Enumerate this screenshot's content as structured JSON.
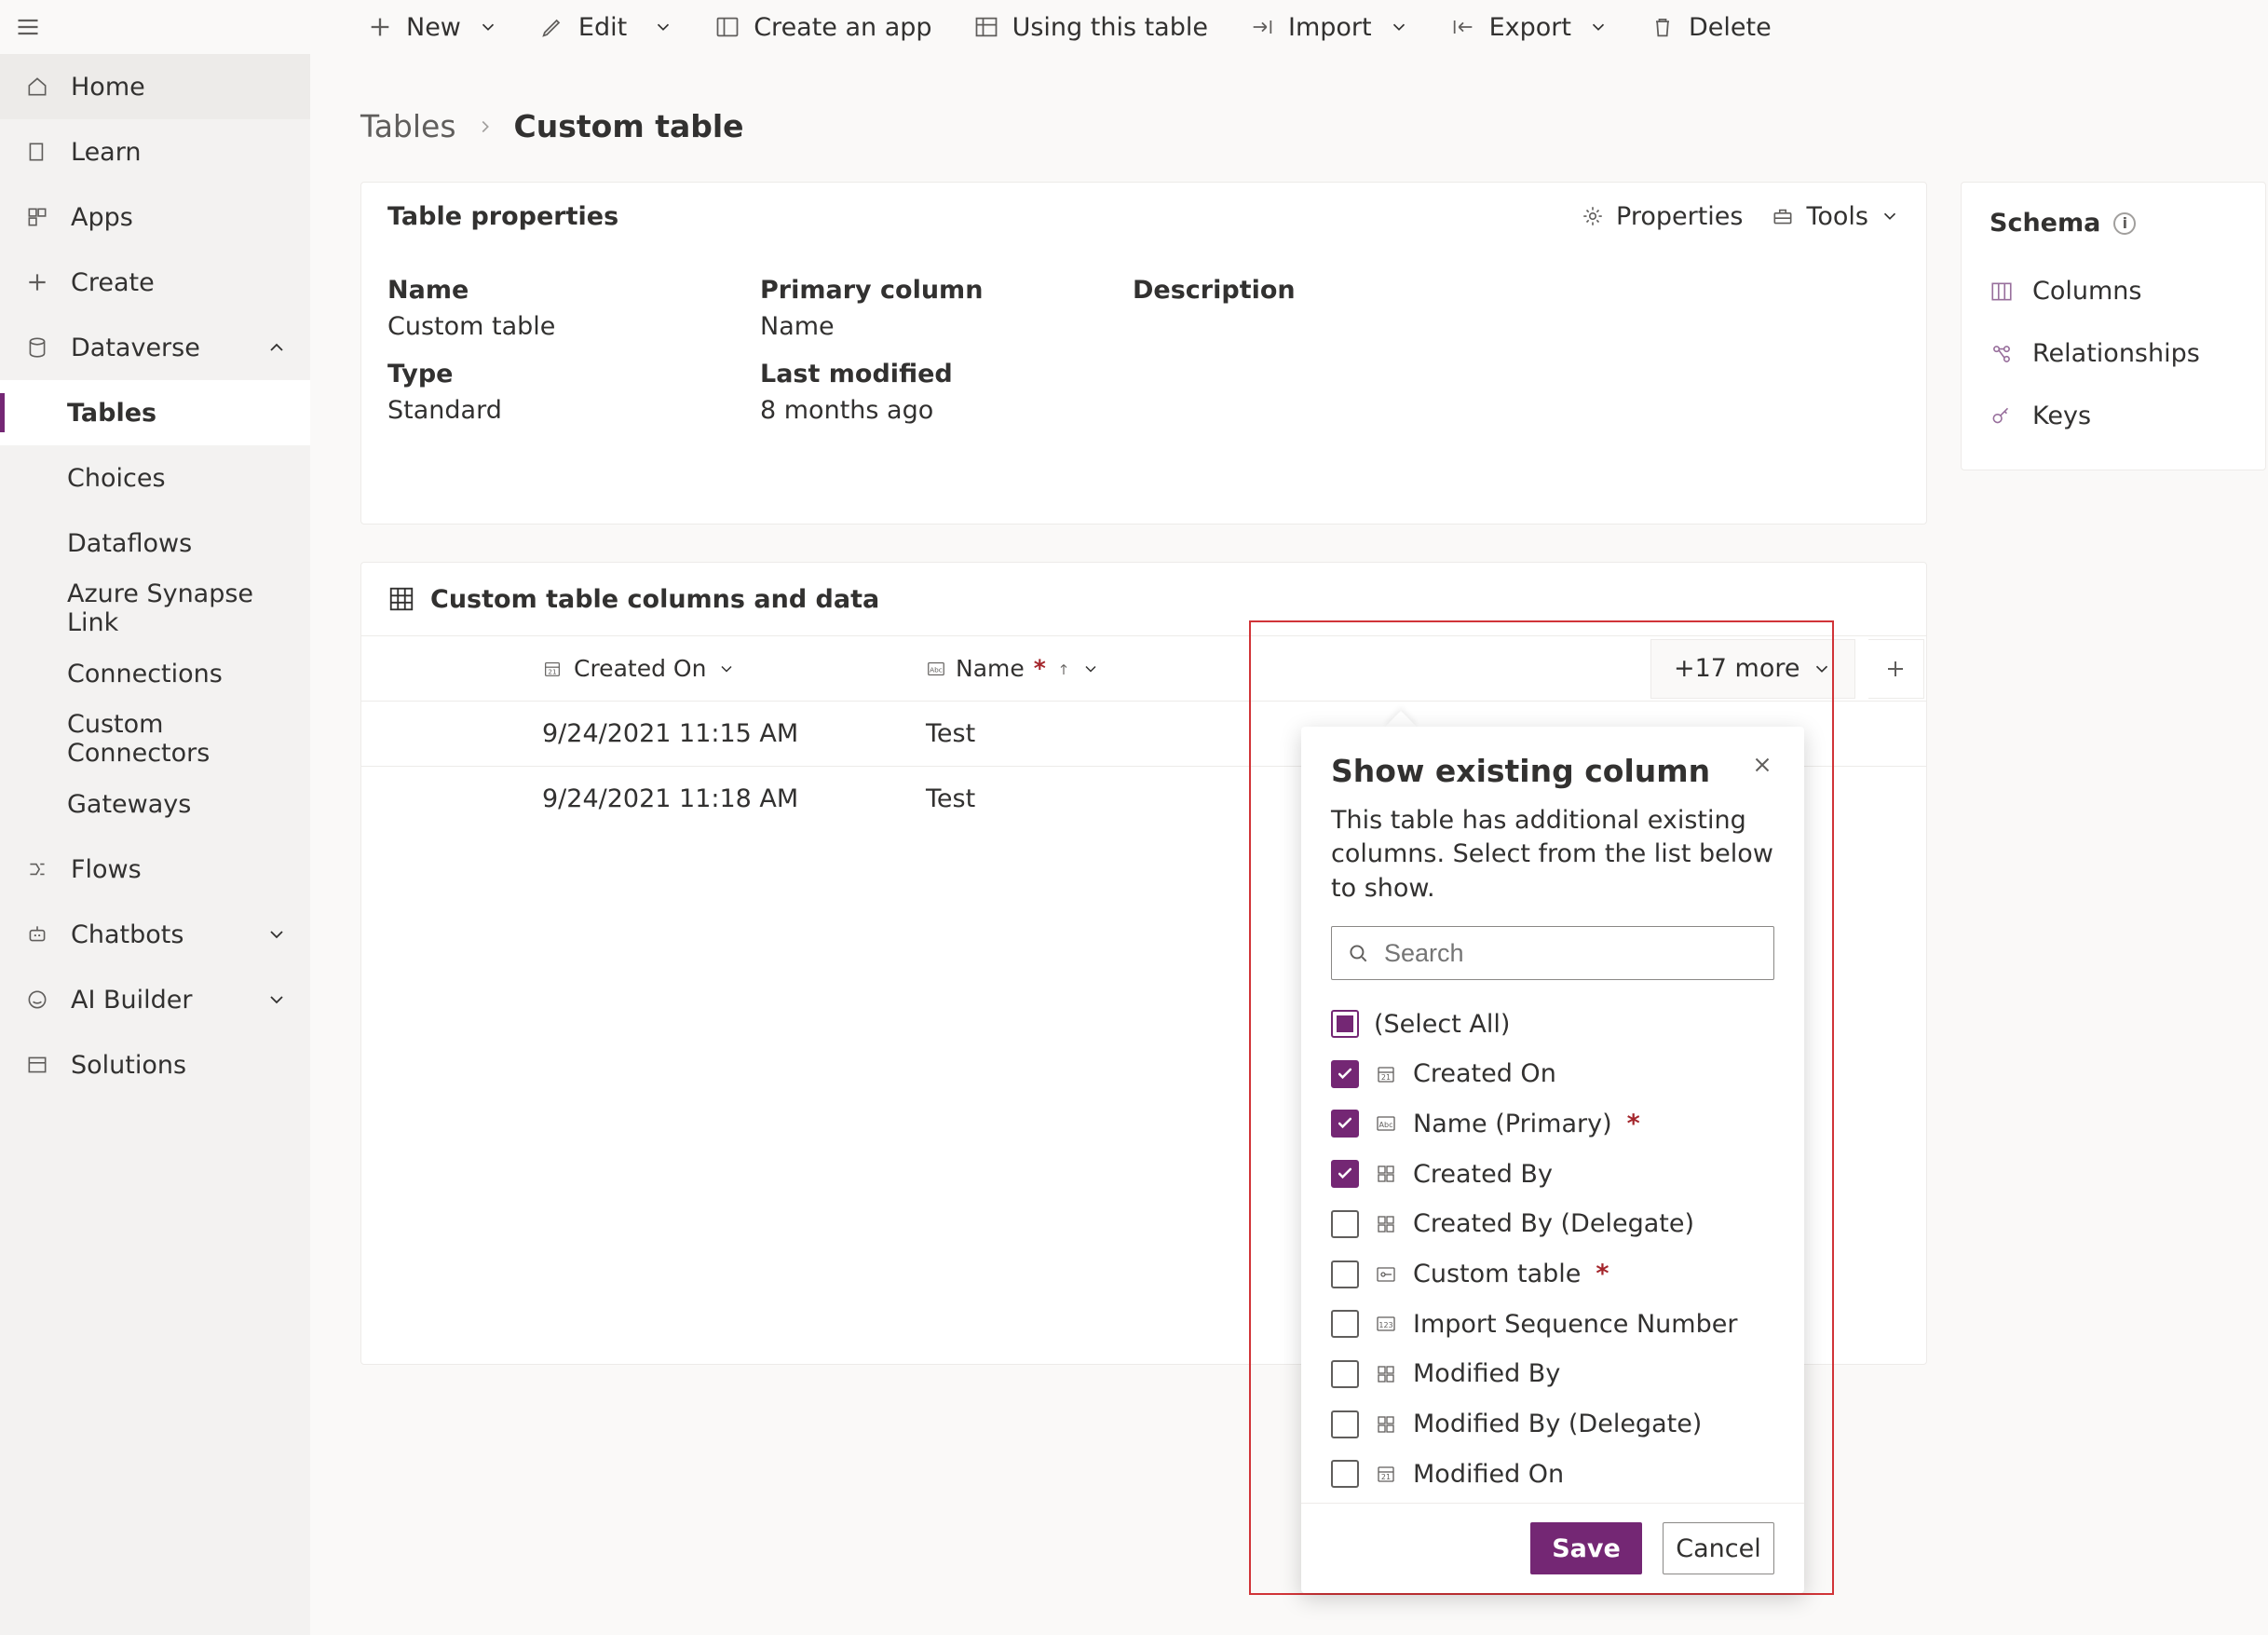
{
  "commandbar": {
    "new": "New",
    "edit": "Edit",
    "create_app": "Create an app",
    "using_table": "Using this table",
    "import": "Import",
    "export": "Export",
    "delete": "Delete"
  },
  "nav": {
    "home": "Home",
    "learn": "Learn",
    "apps": "Apps",
    "create": "Create",
    "dataverse": "Dataverse",
    "tables": "Tables",
    "choices": "Choices",
    "dataflows": "Dataflows",
    "synapse": "Azure Synapse Link",
    "connections": "Connections",
    "custom_connectors": "Custom Connectors",
    "gateways": "Gateways",
    "flows": "Flows",
    "chatbots": "Chatbots",
    "ai_builder": "AI Builder",
    "solutions": "Solutions"
  },
  "breadcrumb": {
    "tables": "Tables",
    "current": "Custom table"
  },
  "props": {
    "card_title": "Table properties",
    "properties_btn": "Properties",
    "tools_btn": "Tools",
    "labels": {
      "name": "Name",
      "primary": "Primary column",
      "description": "Description",
      "type": "Type",
      "last_modified": "Last modified"
    },
    "values": {
      "name": "Custom table",
      "primary": "Name",
      "description": "",
      "type": "Standard",
      "last_modified": "8 months ago"
    }
  },
  "schema": {
    "title": "Schema",
    "columns": "Columns",
    "relationships": "Relationships",
    "keys": "Keys"
  },
  "grid": {
    "title": "Custom table columns and data",
    "col_created": "Created On",
    "col_name": "Name",
    "more_label": "+17 more",
    "rows": [
      {
        "created": "9/24/2021 11:15 AM",
        "name": "Test"
      },
      {
        "created": "9/24/2021 11:18 AM",
        "name": "Test"
      }
    ]
  },
  "popover": {
    "title": "Show existing column",
    "desc": "This table has additional existing columns. Select from the list below to show.",
    "search_placeholder": "Search",
    "select_all": "(Select All)",
    "save": "Save",
    "cancel": "Cancel",
    "items": [
      {
        "label": "Created On",
        "checked": true,
        "icon": "date"
      },
      {
        "label": "Name (Primary)",
        "checked": true,
        "required": true,
        "icon": "text"
      },
      {
        "label": "Created By",
        "checked": true,
        "icon": "lookup"
      },
      {
        "label": "Created By (Delegate)",
        "checked": false,
        "icon": "lookup"
      },
      {
        "label": "Custom table",
        "checked": false,
        "required": true,
        "icon": "key"
      },
      {
        "label": "Import Sequence Number",
        "checked": false,
        "icon": "number"
      },
      {
        "label": "Modified By",
        "checked": false,
        "icon": "lookup"
      },
      {
        "label": "Modified By (Delegate)",
        "checked": false,
        "icon": "lookup"
      },
      {
        "label": "Modified On",
        "checked": false,
        "icon": "date"
      }
    ]
  }
}
